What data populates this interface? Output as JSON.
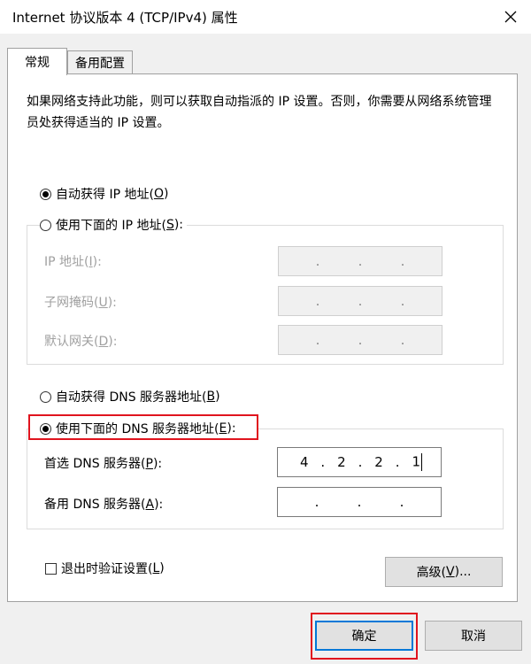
{
  "window": {
    "title": "Internet 协议版本 4 (TCP/IPv4) 属性",
    "close_icon": "close-icon"
  },
  "tabs": [
    {
      "label": "常规"
    },
    {
      "label": "备用配置"
    }
  ],
  "description": "如果网络支持此功能，则可以获取自动指派的 IP 设置。否则，你需要从网络系统管理员处获得适当的 IP 设置。",
  "ip_settings": {
    "auto_option": {
      "label_pre": "自动获得 IP 地址(",
      "accel": "O",
      "label_post": ")",
      "selected": true
    },
    "manual_option": {
      "label_pre": "使用下面的 IP 地址(",
      "accel": "S",
      "label_post": "):",
      "selected": false
    },
    "ip_address": {
      "label_pre": "IP 地址(",
      "accel": "I",
      "label_post": "):",
      "value": [
        ".",
        ".",
        "."
      ]
    },
    "subnet_mask": {
      "label_pre": "子网掩码(",
      "accel": "U",
      "label_post": "):",
      "value": [
        ".",
        ".",
        "."
      ]
    },
    "default_gateway": {
      "label_pre": "默认网关(",
      "accel": "D",
      "label_post": "):",
      "value": [
        ".",
        ".",
        "."
      ]
    }
  },
  "dns_settings": {
    "auto_option": {
      "label_pre": "自动获得 DNS 服务器地址(",
      "accel": "B",
      "label_post": ")",
      "selected": false
    },
    "manual_option": {
      "label_pre": "使用下面的 DNS 服务器地址(",
      "accel": "E",
      "label_post": "):",
      "selected": true
    },
    "preferred": {
      "label_pre": "首选 DNS 服务器(",
      "accel": "P",
      "label_post": "):",
      "octets": [
        "4",
        "2",
        "2",
        "1"
      ]
    },
    "alternate": {
      "label_pre": "备用 DNS 服务器(",
      "accel": "A",
      "label_post": "):",
      "value": [
        ".",
        ".",
        "."
      ]
    }
  },
  "validate_on_exit": {
    "label_pre": "退出时验证设置(",
    "accel": "L",
    "label_post": ")",
    "checked": false
  },
  "buttons": {
    "advanced": {
      "label_pre": "高级(",
      "accel": "V",
      "label_post": ")..."
    },
    "ok": "确定",
    "cancel": "取消"
  },
  "highlight_color": "#e0141e"
}
